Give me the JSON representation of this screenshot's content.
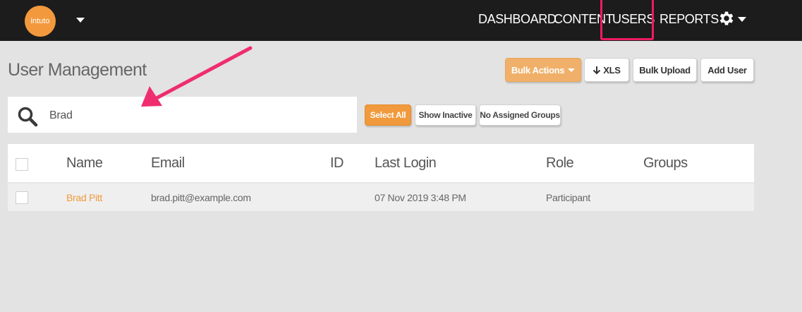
{
  "app": {
    "logo_text": "intuto",
    "brand_color": "#f2993e",
    "accent_highlight": "#ee1b63"
  },
  "nav": {
    "items": [
      {
        "label": "DASHBOARD"
      },
      {
        "label": "CONTENT"
      },
      {
        "label": "USERS",
        "active": true
      },
      {
        "label": "REPORTS"
      }
    ],
    "settings_icon": "gear-icon"
  },
  "page": {
    "title": "User Management"
  },
  "toolbar": {
    "bulk_actions": "Bulk Actions",
    "xls": "XLS",
    "bulk_upload": "Bulk Upload",
    "add_user": "Add User"
  },
  "search": {
    "value": "Brad",
    "icon": "search-icon"
  },
  "filters": {
    "select_all": "Select All",
    "show_inactive": "Show Inactive",
    "no_assigned_groups": "No Assigned Groups"
  },
  "table": {
    "columns": [
      "Name",
      "Email",
      "ID",
      "Last Login",
      "Role",
      "Groups"
    ],
    "rows": [
      {
        "name": "Brad Pitt",
        "email": "brad.pitt@example.com",
        "id": "",
        "last_login": "07 Nov 2019 3:48 PM",
        "role": "Participant",
        "groups": ""
      }
    ]
  }
}
